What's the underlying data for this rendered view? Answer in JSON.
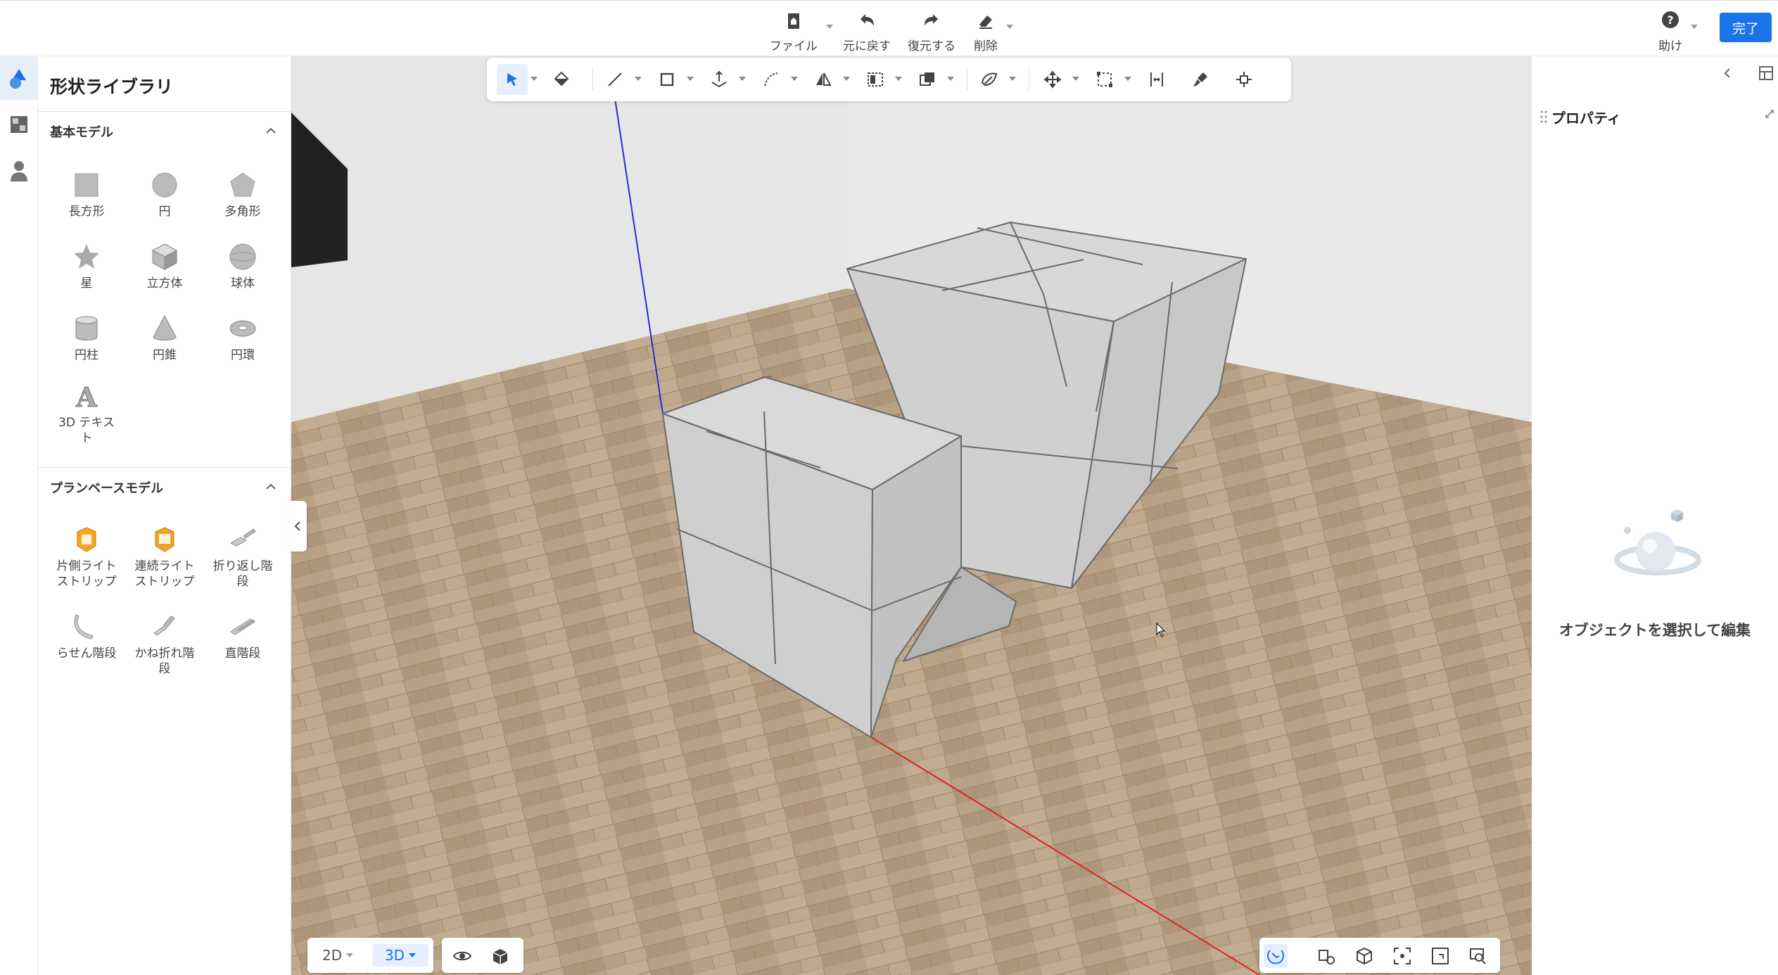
{
  "topbar": {
    "file_label": "ファイル",
    "undo_label": "元に戻す",
    "redo_label": "復元する",
    "delete_label": "削除",
    "help_label": "助け",
    "done_label": "完了"
  },
  "library": {
    "title": "形状ライブラリ",
    "basic_section": "基本モデル",
    "basic_items": [
      "長方形",
      "円",
      "多角形",
      "星",
      "立方体",
      "球体",
      "円柱",
      "円錐",
      "円環",
      "3D テキスト"
    ],
    "plan_section": "プランベースモデル",
    "plan_items": [
      "片側ライトストリップ",
      "連続ライトストリップ",
      "折り返し階段",
      "らせん階段",
      "かね折れ階段",
      "直階段"
    ]
  },
  "properties": {
    "title": "プロパティ",
    "empty_message": "オブジェクトを選択して編集"
  },
  "view": {
    "mode_2d": "2D",
    "mode_3d": "3D",
    "active_mode": "3D"
  },
  "colors": {
    "accent": "#1a73e8",
    "floor": "#b9a48a",
    "wall": "#e4e4e4",
    "cube_top": "#d6d6d6",
    "cube_side": "#c4c4c4",
    "axis_x": "#e0231c",
    "axis_z": "#2b2bd6"
  }
}
